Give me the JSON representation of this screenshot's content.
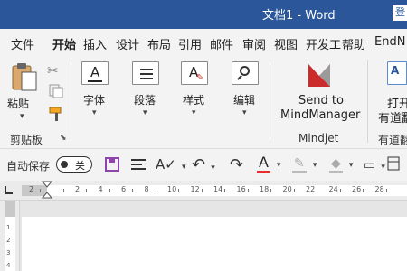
{
  "title": "文档1  -  Word",
  "signin": "登",
  "tabs": [
    "文件",
    "开始",
    "插入",
    "设计",
    "布局",
    "引用",
    "邮件",
    "审阅",
    "视图",
    "开发工",
    "帮助",
    "EndN"
  ],
  "clipboard": {
    "paste": "粘贴",
    "group": "剪贴板"
  },
  "buttons": {
    "font": "字体",
    "paragraph": "段落",
    "style": "样式",
    "edit": "编辑"
  },
  "mindjet": {
    "line1": "Send to",
    "line2": "MindManager",
    "group": "Mindjet"
  },
  "youdao": {
    "line1": "打开",
    "line2": "有道翻",
    "group": "有道翻"
  },
  "qat": {
    "autosave": "自动保存",
    "toggle": "关"
  },
  "ruler": {
    "ticks": [
      "2",
      "",
      "2",
      "4",
      "6",
      "8",
      "10",
      "12",
      "14",
      "16",
      "18",
      "20",
      "22",
      "24",
      "26",
      "28"
    ],
    "vticks": [
      "1",
      "2",
      "3",
      "4"
    ]
  },
  "colors": {
    "titlebar": "#2b579a",
    "font_color": "#e03030",
    "highlight": "#f2e640"
  }
}
